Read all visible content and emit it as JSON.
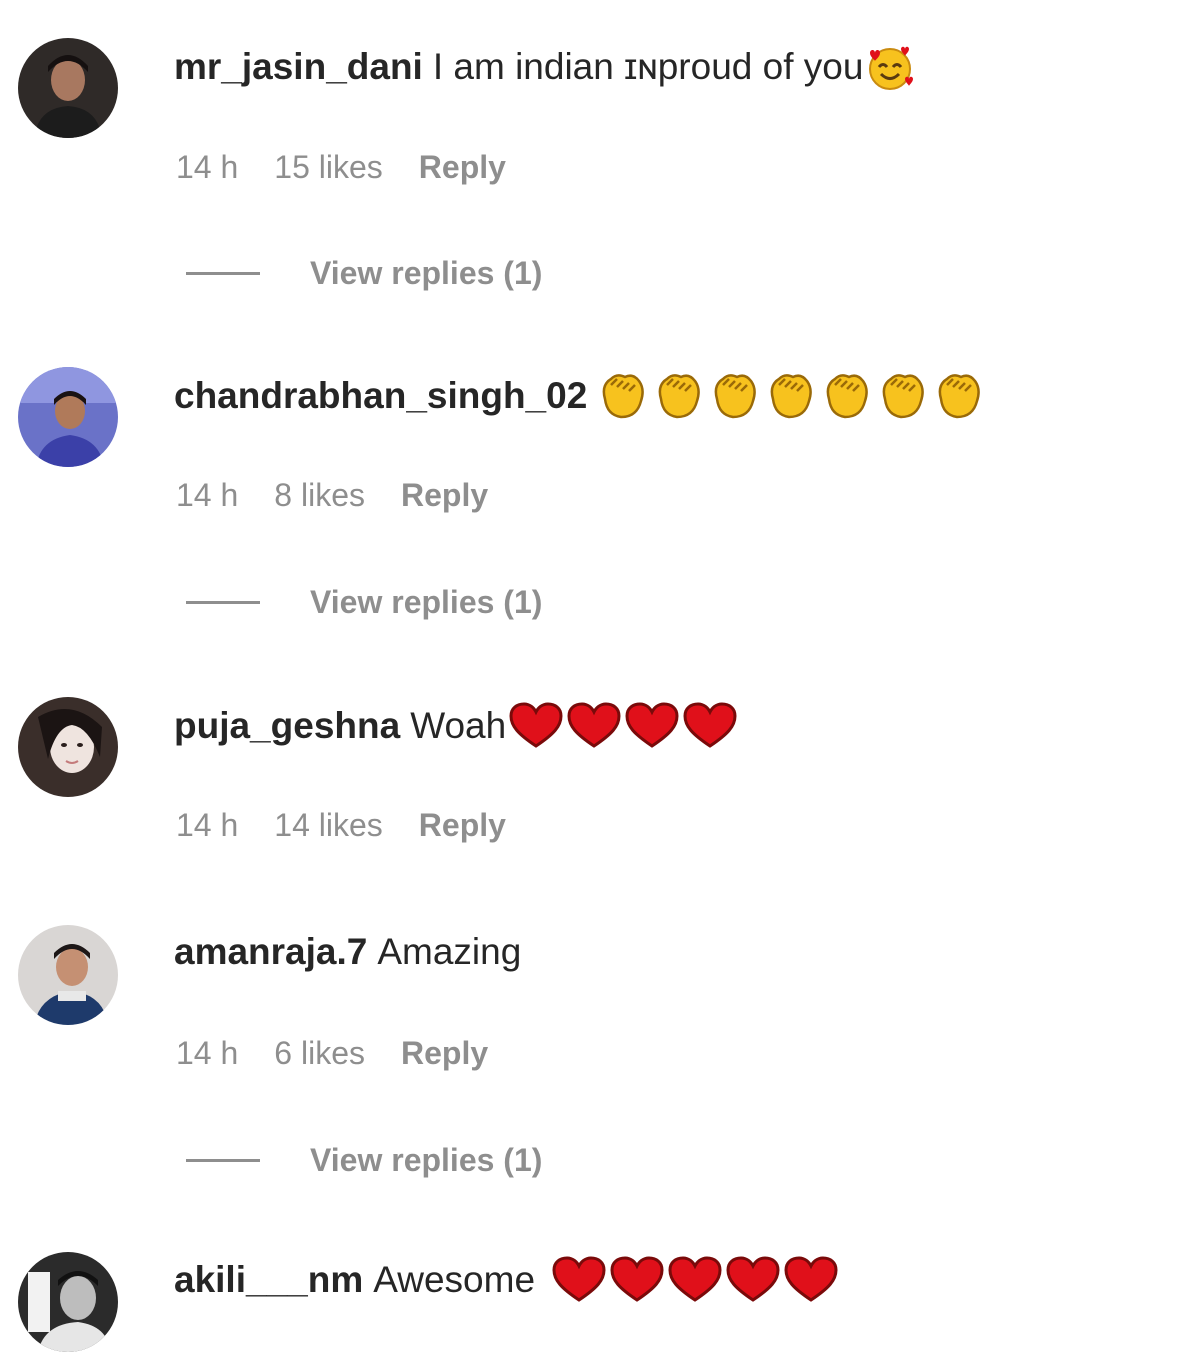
{
  "comments": [
    {
      "username": "mr_jasin_dani",
      "text": "I am indian ɪɴproud of you",
      "emojis": [
        "smiling-face-with-hearts"
      ],
      "time": "14 h",
      "likes": "15 likes",
      "reply_label": "Reply",
      "view_replies": "View replies (1)"
    },
    {
      "username": "chandrabhan_singh_02",
      "text": "",
      "emojis": [
        "clapping-hands",
        "clapping-hands",
        "clapping-hands",
        "clapping-hands",
        "clapping-hands",
        "clapping-hands",
        "clapping-hands"
      ],
      "time": "14 h",
      "likes": "8 likes",
      "reply_label": "Reply",
      "view_replies": "View replies (1)"
    },
    {
      "username": "puja_geshna",
      "text": "Woah",
      "emojis": [
        "red-heart",
        "red-heart",
        "red-heart",
        "red-heart"
      ],
      "time": "14 h",
      "likes": "14 likes",
      "reply_label": "Reply"
    },
    {
      "username": "amanraja.7",
      "text": "Amazing",
      "emojis": [],
      "time": "14 h",
      "likes": "6 likes",
      "reply_label": "Reply",
      "view_replies": "View replies (1)"
    },
    {
      "username": "akili___nm",
      "text": "Awesome",
      "emojis": [
        "red-heart",
        "red-heart",
        "red-heart",
        "red-heart",
        "red-heart"
      ]
    }
  ],
  "colors": {
    "primary_text": "#262626",
    "secondary_text": "#8e8e8e",
    "heart": "#e0101a",
    "clap": "#f7c21e"
  }
}
